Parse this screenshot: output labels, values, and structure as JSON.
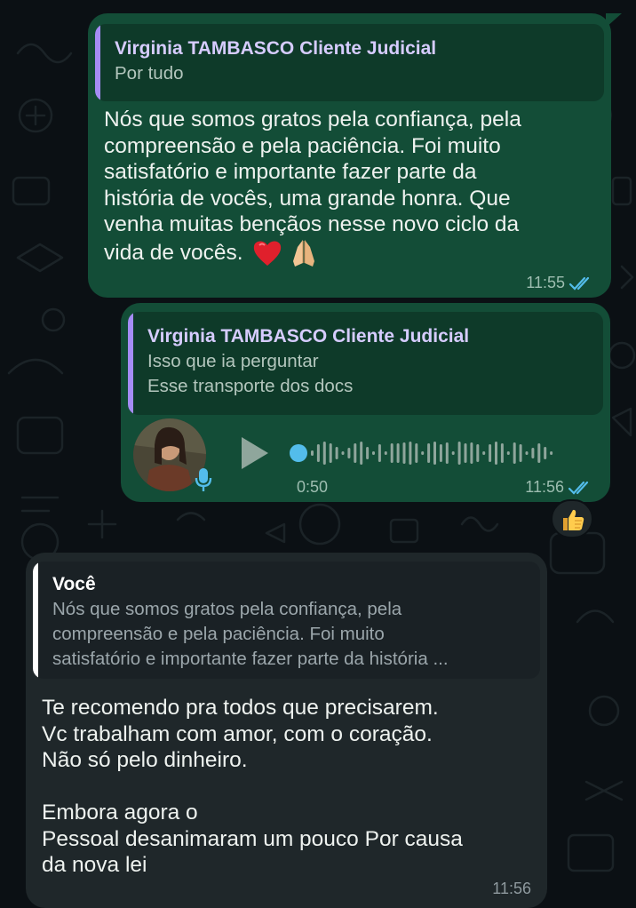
{
  "colors": {
    "background": "#0b1014",
    "outgoing_bubble": "#134d37",
    "incoming_bubble": "#1f272a",
    "quote_bar_contact": "#a58cf5",
    "quote_bar_self": "#ffffff",
    "read_ticks": "#53bdeb"
  },
  "messages": [
    {
      "quote": {
        "author": "Virginia TAMBASCO Cliente Judicial",
        "lines": [
          "Por tudo"
        ]
      },
      "lines": [
        "Nós que somos gratos pela confiança, pela",
        "compreensão e pela paciência. Foi muito",
        "satisfatório e importante fazer parte da",
        "história de vocês, uma grande honra. Que",
        "venha muitas bençãos nesse novo ciclo da",
        "vida de vocês."
      ],
      "emojis": [
        "red-heart-icon",
        "folded-hands-icon"
      ],
      "time": "11:55",
      "status_icon": "double-check-read-icon"
    },
    {
      "quote": {
        "author": "Virginia TAMBASCO Cliente Judicial",
        "lines": [
          "Isso que ia perguntar",
          "Esse transporte dos docs"
        ]
      },
      "voice": {
        "duration": "0:50",
        "progress": 0,
        "play_icon": "play-icon",
        "mic_icon": "microphone-icon"
      },
      "time": "11:56",
      "status_icon": "double-check-read-icon",
      "reaction": "thumbs-up-icon"
    },
    {
      "quote": {
        "author": "Você",
        "lines": [
          "Nós que somos gratos pela confiança, pela",
          "compreensão e pela paciência. Foi muito",
          "satisfatório e importante fazer parte da história ..."
        ]
      },
      "lines": [
        "Te recomendo pra todos que precisarem.",
        "Vc trabalham com amor, com o coração.",
        "Não só pelo dinheiro.",
        "",
        "Embora agora o",
        "Pessoal desanimaram um pouco Por causa",
        "da nova lei"
      ],
      "time": "11:56"
    }
  ]
}
